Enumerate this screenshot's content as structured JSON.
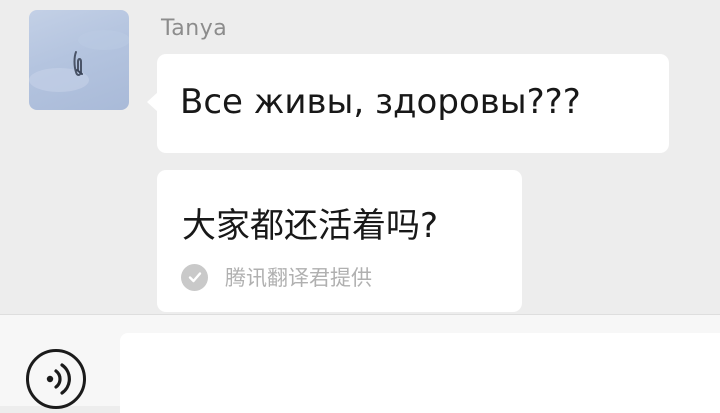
{
  "chat": {
    "sender_name": "Tanya",
    "message_text": "Все живы, здоровы???",
    "translation": {
      "text": "大家都还活着吗?",
      "provider": "腾讯翻译君提供",
      "provider_icon": "check-circle-icon"
    }
  },
  "input_bar": {
    "voice_icon": "voice-icon",
    "input_value": ""
  },
  "colors": {
    "background": "#ededed",
    "bubble": "#ffffff",
    "sender_name": "#8c8c8c",
    "provider_text": "#b0b0b0"
  }
}
